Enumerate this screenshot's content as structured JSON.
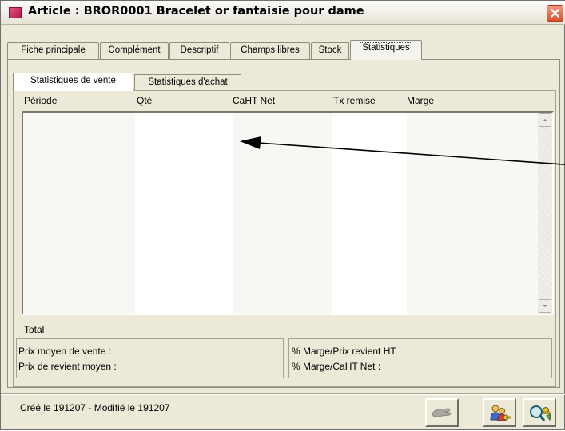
{
  "window": {
    "title": "Article : BROR0001 Bracelet or fantaisie pour dame",
    "app_icon": "article-icon",
    "close_icon": "close-icon"
  },
  "tabs": [
    {
      "label": "Fiche principale",
      "active": false
    },
    {
      "label": "Complément",
      "active": false
    },
    {
      "label": "Descriptif",
      "active": false
    },
    {
      "label": "Champs libres",
      "active": false
    },
    {
      "label": "Stock",
      "active": false
    },
    {
      "label": "Statistiques",
      "active": true
    }
  ],
  "subtabs": [
    {
      "label": "Statistiques de vente",
      "active": true
    },
    {
      "label": "Statistiques d'achat",
      "active": false
    }
  ],
  "table": {
    "columns": [
      "Période",
      "Qté",
      "CaHT Net",
      "Tx remise",
      "Marge"
    ],
    "rows": []
  },
  "summary": {
    "total_label": "Total",
    "left": [
      "Prix moyen de vente :",
      "Prix de revient moyen :"
    ],
    "right": [
      "% Marge/Prix revient HT :",
      "% Marge/CaHT Net :"
    ]
  },
  "status": {
    "text": "Créé le 191207 - Modifié le 191207"
  },
  "buttons": [
    {
      "icon": "hand-icon",
      "enabled": false
    },
    {
      "icon": "users-key-icon",
      "enabled": true
    },
    {
      "icon": "search-keys-icon",
      "enabled": true
    }
  ]
}
